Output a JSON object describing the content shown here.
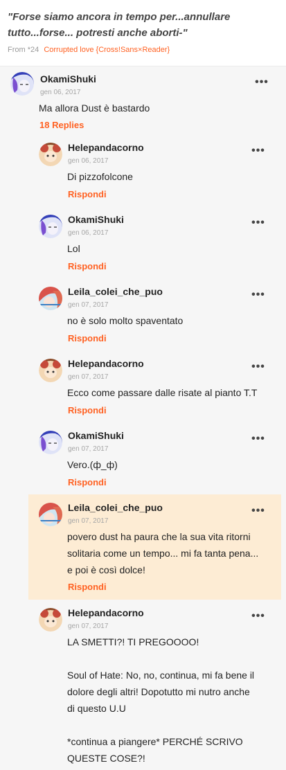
{
  "quote": {
    "text": "\"Forse siamo ancora in tempo per...annullare tutto...forse... potresti anche aborti-\"",
    "from_label": "From *24",
    "story": "Corrupted love {Cross!Sans×Reader}"
  },
  "comment": {
    "user": "OkamiShuki",
    "date": "gen 06, 2017",
    "text": "Ma allora Dust è bastardo",
    "replies_label": "18 Replies",
    "more_label": "•••"
  },
  "replies": [
    {
      "user": "Helepandacorno",
      "date": "gen 06, 2017",
      "text": "Di pizzofolcone",
      "action": "Rispondi",
      "more": "•••"
    },
    {
      "user": "OkamiShuki",
      "date": "gen 06, 2017",
      "text": "Lol",
      "action": "Rispondi",
      "more": "•••"
    },
    {
      "user": "Leila_colei_che_puo",
      "date": "gen 07, 2017",
      "text": "no è solo molto spaventato",
      "action": "Rispondi",
      "more": "•••"
    },
    {
      "user": "Helepandacorno",
      "date": "gen 07, 2017",
      "text": "Ecco come passare dalle risate al pianto T.T",
      "action": "Rispondi",
      "more": "•••"
    },
    {
      "user": "OkamiShuki",
      "date": "gen 07, 2017",
      "text": "Vero.(ф_ф)",
      "action": "Rispondi",
      "more": "•••"
    },
    {
      "user": "Leila_colei_che_puo",
      "date": "gen 07, 2017",
      "text_lines": [
        "povero dust ha paura che la sua vita ritorni",
        "solitaria come un tempo... mi fa tanta pena...",
        "e poi è così dolce!"
      ],
      "action": "Rispondi",
      "more": "•••"
    },
    {
      "user": "Helepandacorno",
      "date": "gen 07, 2017",
      "text_lines": [
        "LA SMETTI?! TI PREGOOOO!",
        "",
        "Soul of Hate: No, no, continua, mi fa bene il",
        "dolore degli altri! Dopotutto mi nutro anche",
        "di questo U.U",
        "",
        "*continua a piangere* PERCHÉ SCRIVO",
        "QUESTE COSE?!"
      ],
      "more": "•••"
    }
  ]
}
